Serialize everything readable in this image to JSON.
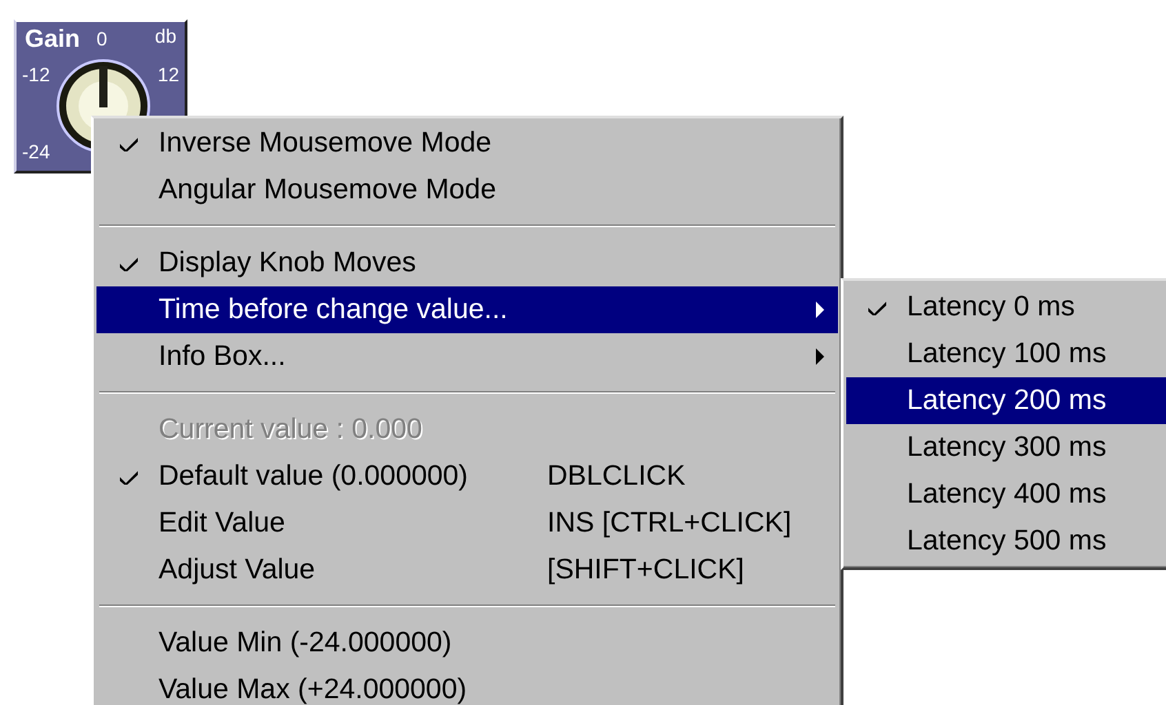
{
  "knob": {
    "title": "Gain",
    "unit": "db",
    "scale": [
      "0",
      "-12",
      "12",
      "-24"
    ]
  },
  "menu": {
    "items": [
      {
        "kind": "item",
        "label": "Inverse Mousemove Mode",
        "checked": true,
        "selected": false,
        "disabled": false,
        "submenu": false
      },
      {
        "kind": "item",
        "label": "Angular Mousemove Mode",
        "checked": false,
        "selected": false,
        "disabled": false,
        "submenu": false
      },
      {
        "kind": "separator"
      },
      {
        "kind": "item",
        "label": "Display Knob Moves",
        "checked": true,
        "selected": false,
        "disabled": false,
        "submenu": false
      },
      {
        "kind": "item",
        "label": "Time before change value...",
        "checked": false,
        "selected": true,
        "disabled": false,
        "submenu": true
      },
      {
        "kind": "item",
        "label": "Info Box...",
        "checked": false,
        "selected": false,
        "disabled": false,
        "submenu": true
      },
      {
        "kind": "separator"
      },
      {
        "kind": "item",
        "label": "Current value : 0.000",
        "checked": false,
        "selected": false,
        "disabled": true,
        "submenu": false
      },
      {
        "kind": "item",
        "label": "Default value (0.000000)",
        "shortcut": "DBLCLICK",
        "checked": true,
        "selected": false,
        "disabled": false,
        "submenu": false
      },
      {
        "kind": "item",
        "label": "Edit Value",
        "shortcut": "INS [CTRL+CLICK]",
        "checked": false,
        "selected": false,
        "disabled": false,
        "submenu": false
      },
      {
        "kind": "item",
        "label": "Adjust Value",
        "shortcut": "[SHIFT+CLICK]",
        "checked": false,
        "selected": false,
        "disabled": false,
        "submenu": false
      },
      {
        "kind": "separator"
      },
      {
        "kind": "item",
        "label": "Value Min (-24.000000)",
        "checked": false,
        "selected": false,
        "disabled": false,
        "submenu": false
      },
      {
        "kind": "item",
        "label": "Value Max (+24.000000)",
        "checked": false,
        "selected": false,
        "disabled": false,
        "submenu": false
      }
    ]
  },
  "submenu": {
    "items": [
      {
        "label": "Latency 0 ms",
        "checked": true,
        "selected": false
      },
      {
        "label": "Latency 100 ms",
        "checked": false,
        "selected": false
      },
      {
        "label": "Latency 200 ms",
        "checked": false,
        "selected": true
      },
      {
        "label": "Latency 300 ms",
        "checked": false,
        "selected": false
      },
      {
        "label": "Latency 400 ms",
        "checked": false,
        "selected": false
      },
      {
        "label": "Latency 500 ms",
        "checked": false,
        "selected": false
      }
    ]
  }
}
